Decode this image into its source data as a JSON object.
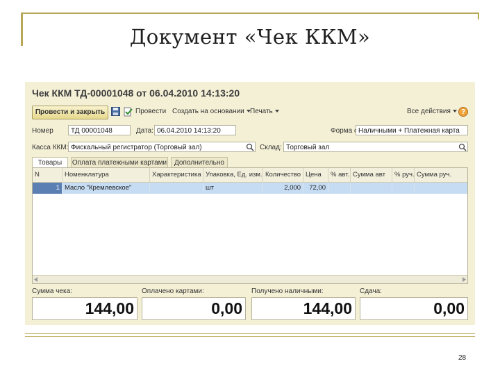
{
  "slide": {
    "title": "Документ «Чек ККМ»",
    "page_number": "28"
  },
  "window": {
    "doc_title": "Чек ККМ ТД-00001048 от 06.04.2010 14:13:20",
    "toolbar": {
      "post_close": "Провести и закрыть",
      "post": "Провести",
      "create_based": "Создать на основании",
      "print": "Печать",
      "all_actions": "Все действия",
      "help": "?"
    },
    "fields": {
      "number_label": "Номер",
      "number_value": "ТД 00001048",
      "date_label": "Дата:",
      "date_value": "06.04.2010 14:13:20",
      "payment_label": "Форма оплаты:",
      "payment_value": "Наличными + Платежная карта",
      "register_label": "Касса ККМ:",
      "register_value": "Фискальный регистратор (Торговый зал)",
      "warehouse_label": "Склад:",
      "warehouse_value": "Торговый зал"
    },
    "tabs": [
      "Товары",
      "Оплата платежными картами",
      "Дополнительно"
    ],
    "grid": {
      "columns": [
        "N",
        "Номенклатура",
        "Характеристика",
        "Упаковка, Ед. изм.",
        "Количество",
        "Цена",
        "% авт.",
        "Сумма авт",
        "% руч.",
        "Сумма руч."
      ],
      "rows": [
        {
          "n": "1",
          "item": "Масло \"Кремлевское\"",
          "characteristic": "",
          "unit": "шт",
          "qty": "2,000",
          "price": "72,00",
          "auto_pct": "",
          "auto_sum": "",
          "man_pct": "",
          "man_sum": ""
        }
      ]
    },
    "totals": {
      "check_sum_label": "Сумма чека:",
      "check_sum_value": "144,00",
      "card_paid_label": "Оплачено картами:",
      "card_paid_value": "0,00",
      "cash_received_label": "Получено наличными:",
      "cash_received_value": "144,00",
      "change_label": "Сдача:",
      "change_value": "0,00"
    }
  },
  "colors": {
    "accent": "#b8a659",
    "window_bg": "#f4f0d6",
    "selected_row": "#c6dcf3"
  }
}
